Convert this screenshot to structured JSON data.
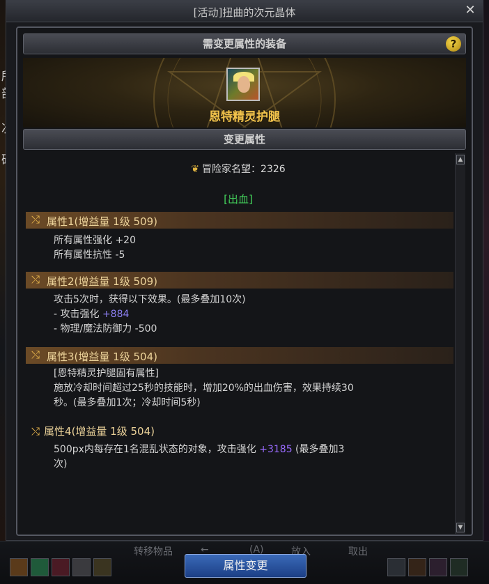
{
  "window": {
    "title": "[活动]扭曲的次元晶体",
    "close_icon": "close-icon"
  },
  "header_equipment": {
    "label": "需变更属性的装备",
    "help_label": "?"
  },
  "item": {
    "name": "恩特精灵护腿"
  },
  "header_change": {
    "label": "变更属性"
  },
  "fame": {
    "icon": "fame-icon",
    "label": "冒险家名望：2326"
  },
  "category": "[出血]",
  "props": [
    {
      "title": "属性1",
      "meta": "(增益量 1级 509)",
      "lines": [
        "所有属性强化 +20",
        "所有属性抗性 -5"
      ]
    },
    {
      "title": "属性2",
      "meta": "(增益量 1级 509)",
      "line1": "攻击5次时，获得以下效果。(最多叠加10次)",
      "line2_prefix": "- 攻击强化 ",
      "line2_value": "+884",
      "line3": "- 物理/魔法防御力 -500"
    },
    {
      "title": "属性3",
      "meta": "(增益量 1级 504)",
      "line1": "[恩特精灵护腿固有属性]",
      "line2": "施放冷却时间超过25秒的技能时，增加20%的出血伤害，效果持续30",
      "line3": "秒。(最多叠加1次；冷却时间5秒)"
    },
    {
      "title": "属性4",
      "meta": "(增益量 1级 504)",
      "line1_prefix": "500px内每存在1名混乱状态的对象，攻击强化 ",
      "line1_value": "+3185",
      "line1_suffix": " (最多叠加3",
      "line2": "次)"
    }
  ],
  "bottom": {
    "ghost_texts": [
      "转移物品",
      "← ",
      "(A)",
      "放入",
      "取出"
    ],
    "apply_label": "属性变更"
  },
  "colors": {
    "accent_gold": "#f2c34b",
    "category_green": "#44d45c",
    "value_purple": "#9a6bff",
    "button_blue": "#2d5aa8"
  }
}
